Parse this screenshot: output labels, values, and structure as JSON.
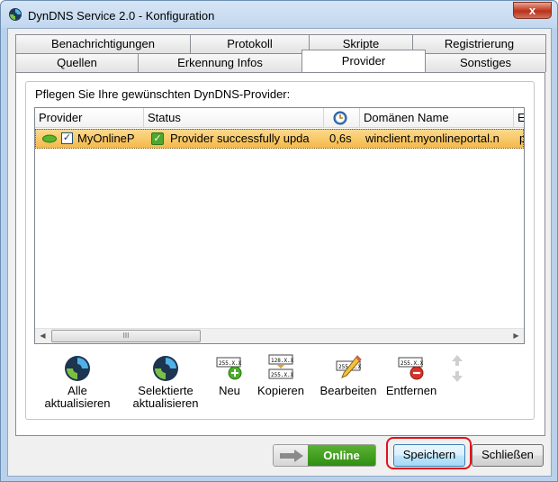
{
  "window": {
    "title": "DynDNS Service 2.0 - Konfiguration",
    "close_glyph": "x"
  },
  "tabs": {
    "row_back": [
      "Benachrichtigungen",
      "Protokoll",
      "Skripte",
      "Registrierung"
    ],
    "row_front": [
      "Quellen",
      "Erkennung Infos",
      "Provider",
      "Sonstiges"
    ],
    "active": "Provider"
  },
  "group": {
    "label": "Pflegen Sie Ihre gewünschten DynDNS-Provider:"
  },
  "grid": {
    "columns": [
      "Provider",
      "Status",
      "clock-icon",
      "Domänen Name",
      "E"
    ],
    "rows": [
      {
        "checked": true,
        "provider": "MyOnlineP",
        "status": "Provider successfully upda",
        "time": "0,6s",
        "domain": "winclient.myonlineportal.n",
        "extra": "p"
      }
    ],
    "scroll_left": "◀",
    "scroll_right": "▶",
    "scroll_grip": "III"
  },
  "toolbar": {
    "update_all": [
      "Alle",
      "aktualisieren"
    ],
    "update_selected": [
      "Selektierte",
      "aktualisieren"
    ],
    "new": "Neu",
    "copy": "Kopieren",
    "edit": "Bearbeiten",
    "remove": "Entfernen",
    "ip_label_a": "255.X.X",
    "ip_label_b": "128.X.X"
  },
  "footer": {
    "online_label": "Online",
    "save_label": "Speichern",
    "close_label": "Schließen"
  },
  "colors": {
    "selected_row": "#f4b94a",
    "online_green": "#3c9b1a",
    "highlight_red": "#e0121b"
  }
}
